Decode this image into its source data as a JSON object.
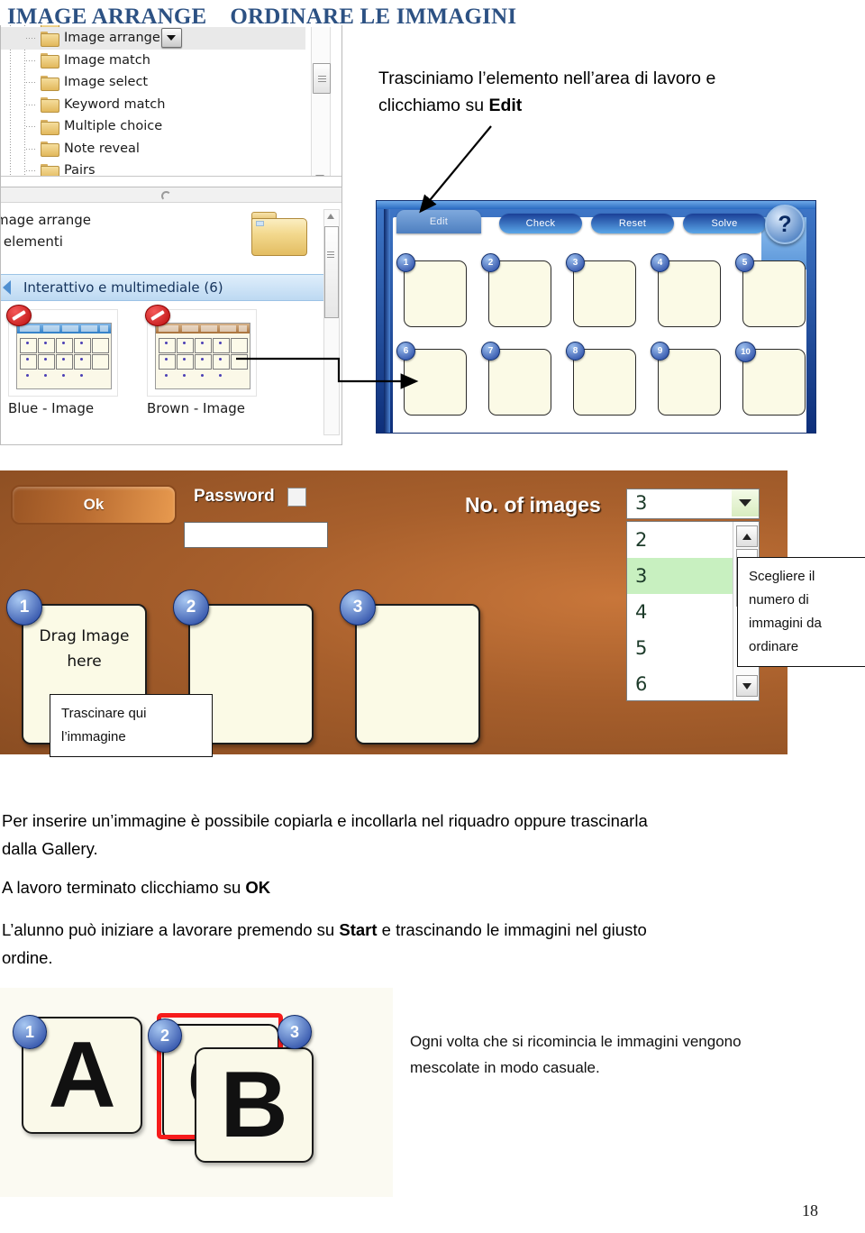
{
  "title": {
    "left": "IMAGE ARRANGE",
    "right": "ORDINARE LE IMMAGINI"
  },
  "figure_tree": {
    "items": [
      {
        "label": "Image arrange",
        "selected": true,
        "has_combo": true
      },
      {
        "label": "Image match",
        "selected": false,
        "has_combo": false
      },
      {
        "label": "Image select",
        "selected": false,
        "has_combo": false
      },
      {
        "label": "Keyword match",
        "selected": false,
        "has_combo": false
      },
      {
        "label": "Multiple choice",
        "selected": false,
        "has_combo": false
      },
      {
        "label": "Note reveal",
        "selected": false,
        "has_combo": false
      },
      {
        "label": "Pairs",
        "selected": false,
        "has_combo": false
      }
    ],
    "folder_icon": "folder-icon",
    "combo_icon": "chevron-down-icon",
    "scrollbar_icon": "vertical-scrollbar"
  },
  "callout_top": {
    "line1": "Trasciniamo l’elemento nell’area di lavoro e",
    "line2_prefix": "clicchiamo su ",
    "line2_bold": "Edit"
  },
  "figure_gallery": {
    "heading_line1": "mage arrange",
    "heading_line2": "i elementi",
    "category": "Interattivo e multimediale (6)",
    "thumbnails": [
      {
        "caption": "Blue - Image",
        "theme": "blue",
        "badge": "no-entry-icon"
      },
      {
        "caption": "Brown - Image",
        "theme": "brown",
        "badge": "no-entry-icon"
      }
    ],
    "folder_icon": "folder-icon"
  },
  "figure_app": {
    "buttons": [
      {
        "label": "Edit",
        "kind": "tab"
      },
      {
        "label": "Check",
        "kind": "pill"
      },
      {
        "label": "Reset",
        "kind": "pill"
      },
      {
        "label": "Solve",
        "kind": "pill"
      }
    ],
    "help_label": "?",
    "slots_row1": [
      "1",
      "2",
      "3",
      "4",
      "5"
    ],
    "slots_row2": [
      "6",
      "7",
      "8",
      "9",
      "10"
    ]
  },
  "figure_editor": {
    "ok_label": "Ok",
    "password_label": "Password",
    "password_value": "",
    "password_placeholder": "",
    "no_of_images_label": "No. of images",
    "selected_value": "3",
    "options": [
      "2",
      "3",
      "4",
      "5",
      "6"
    ],
    "highlighted_option": "3",
    "drop_slots": [
      {
        "number": "1",
        "line1": "Drag Image",
        "line2": "here"
      },
      {
        "number": "2",
        "line1": "",
        "line2": ""
      },
      {
        "number": "3",
        "line1": "",
        "line2": ""
      }
    ]
  },
  "callout_drag": {
    "line1": "Trascinare qui",
    "line2": "l’immagine"
  },
  "callout_choose": {
    "line1": "Scegliere il",
    "line2": "numero di",
    "line3": "immagini da",
    "line4": "ordinare"
  },
  "paragraphs": {
    "p1_line1": "Per inserire un’immagine è possibile copiarla e incollarla nel riquadro oppure trascinarla",
    "p1_line2": "dalla Gallery.",
    "p2_prefix": "A lavoro terminato clicchiamo su ",
    "p2_bold": "OK",
    "p3_prefix": "L’alunno può iniziare a lavorare premendo su ",
    "p3_bold": "Start",
    "p3_suffix": " e trascinando le immagini nel giusto",
    "p3_line2": "ordine."
  },
  "figure_cards": {
    "cards": [
      {
        "number": "1",
        "letter": "A"
      },
      {
        "number": "2",
        "letter": "C"
      },
      {
        "number": "3",
        "letter": "B"
      }
    ]
  },
  "note_right": {
    "line1": "Ogni volta che si ricomincia le immagini vengono",
    "line2": "mescolate in modo casuale."
  },
  "page_number": "18",
  "colors": {
    "title": "#2c5183",
    "app_blue": "#1b3f97",
    "editor_brown": "#a75f2c",
    "highlight_green": "#c8f0c0",
    "red_frame": "#f61b1b",
    "slot_cream": "#fbfae6"
  }
}
